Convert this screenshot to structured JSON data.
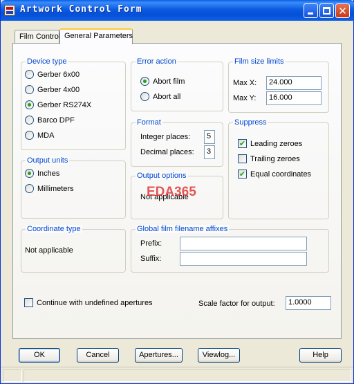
{
  "window": {
    "title": "Artwork Control Form"
  },
  "tabs": [
    {
      "label": "Film Control"
    },
    {
      "label": "General Parameters"
    }
  ],
  "device_type": {
    "label": "Device type",
    "options": [
      "Gerber 6x00",
      "Gerber 4x00",
      "Gerber RS274X",
      "Barco DPF",
      "MDA"
    ],
    "selected": "Gerber RS274X"
  },
  "output_units": {
    "label": "Output units",
    "options": [
      "Inches",
      "Millimeters"
    ],
    "selected": "Inches"
  },
  "coordinate_type": {
    "label": "Coordinate type",
    "text": "Not applicable"
  },
  "error_action": {
    "label": "Error action",
    "options": [
      "Abort film",
      "Abort all"
    ],
    "selected": "Abort film"
  },
  "format": {
    "label": "Format",
    "integer_label": "Integer places:",
    "integer_value": "5",
    "decimal_label": "Decimal places:",
    "decimal_value": "3"
  },
  "output_options": {
    "label": "Output options",
    "text": "Not applicable"
  },
  "watermark": "EDA365",
  "film_size": {
    "label": "Film size limits",
    "max_x_label": "Max X:",
    "max_x": "24.000",
    "max_y_label": "Max Y:",
    "max_y": "16.000"
  },
  "suppress": {
    "label": "Suppress",
    "items": [
      {
        "label": "Leading zeroes",
        "checked": true
      },
      {
        "label": "Trailing zeroes",
        "checked": false
      },
      {
        "label": "Equal coordinates",
        "checked": true
      }
    ]
  },
  "affixes": {
    "label": "Global film filename affixes",
    "prefix_label": "Prefix:",
    "prefix": "",
    "suffix_label": "Suffix:",
    "suffix": ""
  },
  "continue_undefined": {
    "label": "Continue with undefined apertures",
    "checked": false
  },
  "scale": {
    "label": "Scale factor for output:",
    "value": "1.0000"
  },
  "buttons": {
    "ok": "OK",
    "cancel": "Cancel",
    "apertures": "Apertures...",
    "viewlog": "Viewlog...",
    "help": "Help"
  },
  "icons": {
    "close": "✕",
    "check": "✔"
  },
  "colors": {
    "group_label": "#0046d5",
    "title_bar": "#0550d6",
    "radio_dot": "#21a121",
    "watermark": "#e03a3a"
  }
}
